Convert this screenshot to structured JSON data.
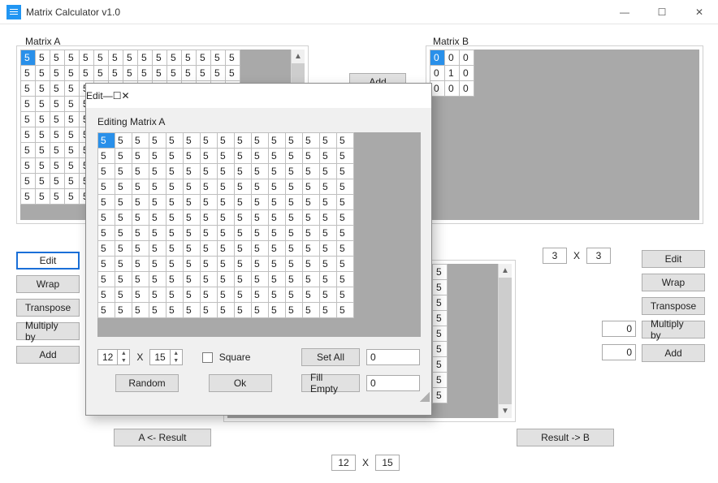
{
  "win": {
    "title": "Matrix Calculator v1.0",
    "icon": "calculator-icon",
    "minimize": "—",
    "maximize": "☐",
    "close": "✕"
  },
  "matrix_a": {
    "label": "Matrix A",
    "cell_value": "5",
    "buttons": {
      "edit": "Edit",
      "wrap": "Wrap",
      "transpose": "Transpose",
      "multiply": "Multiply by",
      "add": "Add"
    }
  },
  "matrix_b": {
    "label": "Matrix B",
    "rows": [
      [
        "0",
        "0",
        "0"
      ],
      [
        "0",
        "1",
        "0"
      ],
      [
        "0",
        "0",
        "0"
      ]
    ],
    "dim_rows": "3",
    "dim_x": "X",
    "dim_cols": "3",
    "multiply_val": "0",
    "add_val": "0",
    "buttons": {
      "edit": "Edit",
      "wrap": "Wrap",
      "transpose": "Transpose",
      "multiply": "Multiply by",
      "add": "Add"
    }
  },
  "center": {
    "add": "Add",
    "a_from_result": "A <- Result",
    "result_to_b": "Result -> B"
  },
  "result": {
    "cell_value": "5",
    "dim_rows": "12",
    "dim_x": "X",
    "dim_cols": "15"
  },
  "dialog": {
    "title": "Edit",
    "minimize": "—",
    "maximize": "☐",
    "close": "✕",
    "heading": "Editing Matrix A",
    "cell_value": "5",
    "dim_rows": "12",
    "dim_x": "X",
    "dim_cols": "15",
    "square_label": "Square",
    "random": "Random",
    "ok": "Ok",
    "set_all": "Set All",
    "set_all_val": "0",
    "fill_empty": "Fill Empty",
    "fill_empty_val": "0"
  }
}
